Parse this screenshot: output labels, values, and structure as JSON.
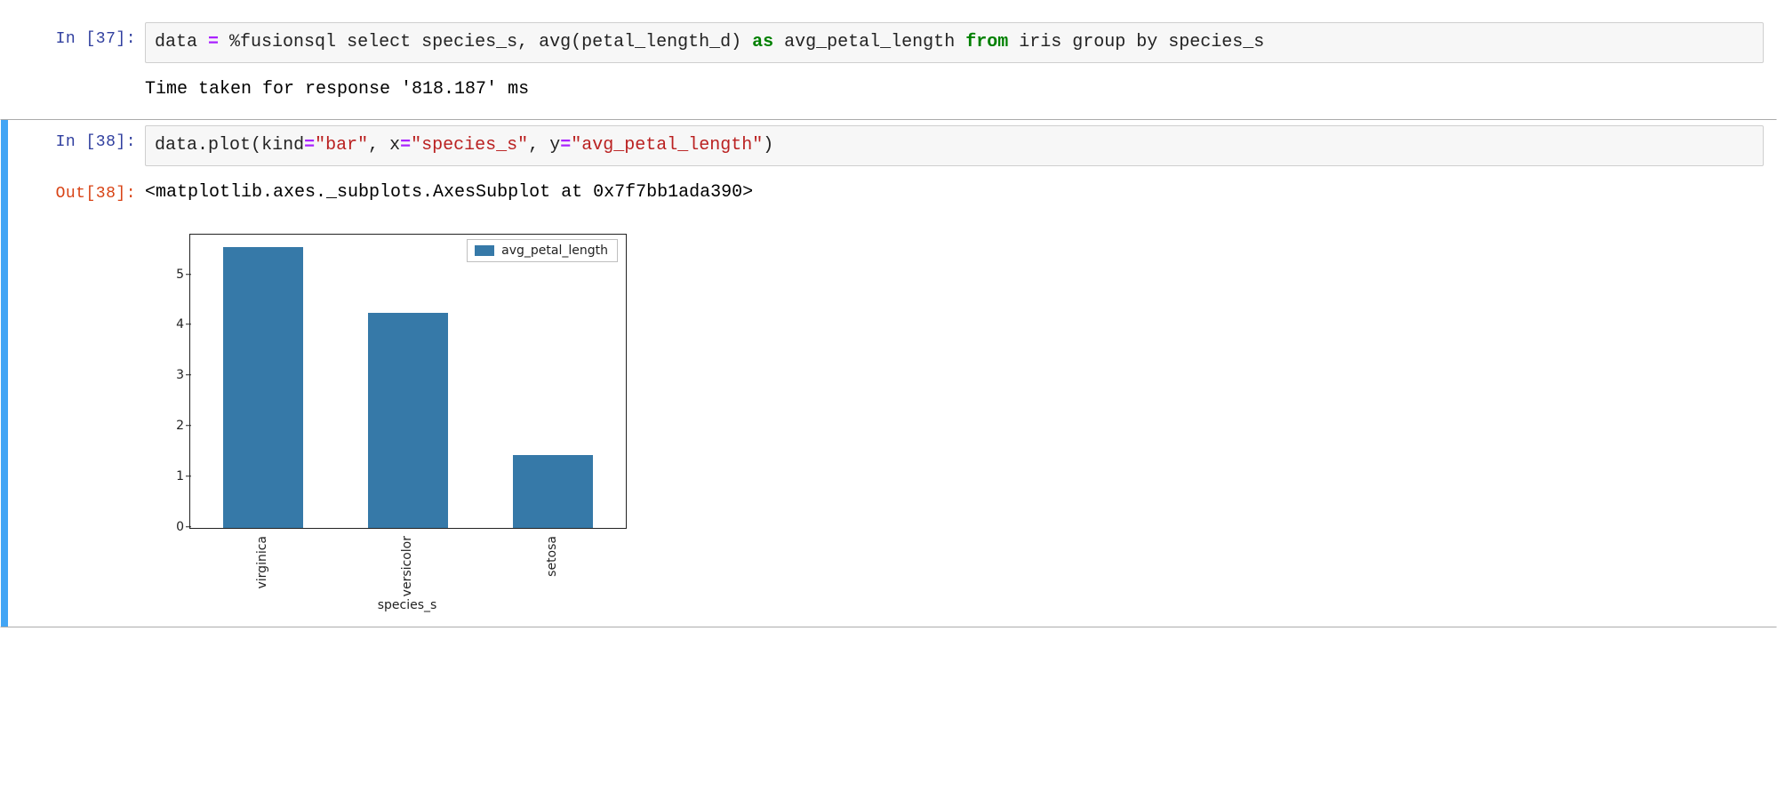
{
  "cells": {
    "c37": {
      "in_label": "In [37]:",
      "code": {
        "var": "data",
        "assign": " = ",
        "magic": "%fusionsql",
        "sql1": " select species_s, avg(petal_length_d) ",
        "kw_as": "as",
        "sql2": " avg_petal_length ",
        "kw_from": "from",
        "sql3": " iris group by species_s"
      },
      "stdout": "Time taken for response '818.187' ms"
    },
    "c38": {
      "in_label": "In [38]:",
      "out_label": "Out[38]:",
      "code": {
        "obj": "data",
        "dot": ".",
        "method": "plot",
        "open": "(",
        "kw1": "kind",
        "eq1": "=",
        "str1": "\"bar\"",
        "sep1": ", ",
        "kw2": "x",
        "eq2": "=",
        "str2": "\"species_s\"",
        "sep2": ", ",
        "kw3": "y",
        "eq3": "=",
        "str3": "\"avg_petal_length\"",
        "close": ")"
      },
      "repr": "<matplotlib.axes._subplots.AxesSubplot at 0x7f7bb1ada390>"
    }
  },
  "chart_data": {
    "type": "bar",
    "categories": [
      "virginica",
      "versicolor",
      "setosa"
    ],
    "values": [
      5.55,
      4.25,
      1.45
    ],
    "series_name": "avg_petal_length",
    "xlabel": "species_s",
    "ylabel": "",
    "yticks": [
      0,
      1,
      2,
      3,
      4,
      5
    ],
    "ylim": [
      0,
      5.8
    ],
    "bar_color": "#3679a8",
    "legend_position": "top-right",
    "legend_label": "avg_petal_length"
  }
}
